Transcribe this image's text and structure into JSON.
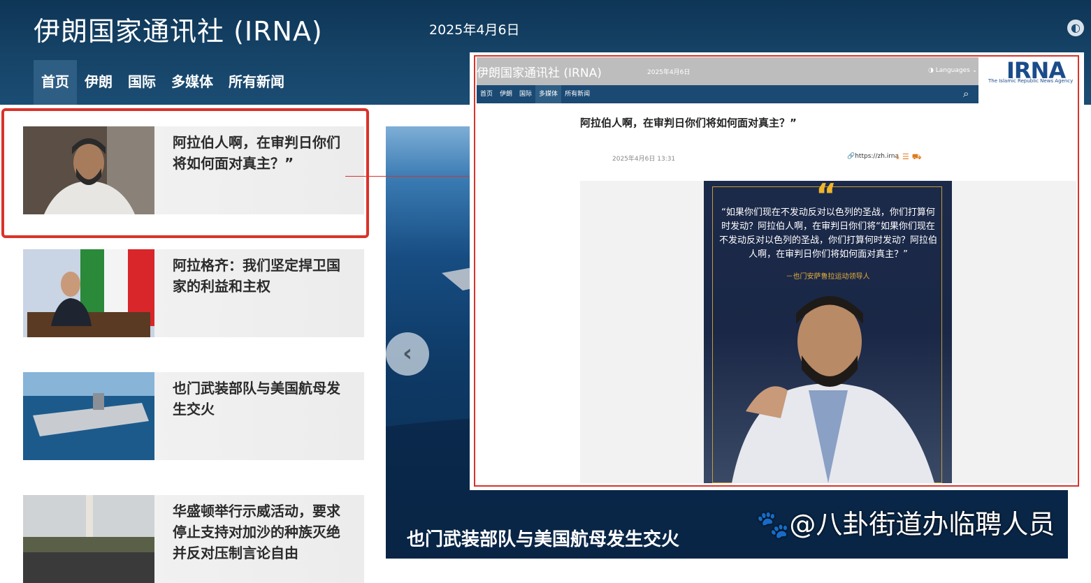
{
  "header": {
    "site_title": "伊朗国家通讯社 (IRNA)",
    "date": "2025年4月6日",
    "nav": [
      "首页",
      "伊朗",
      "国际",
      "多媒体",
      "所有新闻"
    ],
    "active_nav": "首页",
    "globe_icon": "globe-icon"
  },
  "news": [
    {
      "title": "阿拉伯人啊，在审判日你们将如何面对真主？”",
      "thumb": "man-in-white-robe"
    },
    {
      "title": "阿拉格齐：我们坚定捍卫国家的利益和主权",
      "thumb": "speaker-at-podium"
    },
    {
      "title": "也门武装部队与美国航母发生交火",
      "thumb": "aircraft-carrier"
    },
    {
      "title": "华盛顿举行示威活动，要求停止支持对加沙的种族灭绝并反对压制言论自由",
      "thumb": "protest-crowd"
    }
  ],
  "hero": {
    "caption": "也门武装部队与美国航母发生交火",
    "prev_icon": "chevron-left-icon"
  },
  "watermark": "🐾@八卦街道办临聘人员",
  "overlay": {
    "site_title": "伊朗国家通讯社 (IRNA)",
    "date": "2025年4月6日",
    "language": "Languages",
    "logo_text": "IRNA",
    "logo_subtitle": "The Islamic Republic News Agency",
    "nav": [
      "首页",
      "伊朗",
      "国际",
      "多媒体",
      "所有新闻"
    ],
    "active_nav": "多媒体",
    "article_title": "阿拉伯人啊，在审判日你们将如何面对真主？”",
    "article_date": "2025年4月6日 13:31",
    "short_link": "https://zh.irna",
    "poster": {
      "quote_mark": "“",
      "quote": "“如果你们现在不发动反对以色列的圣战，你们打算何时发动？阿拉伯人啊，在审判日你们将“如果你们现在不发动反对以色列的圣战，你们打算何时发动？阿拉伯人啊，在审判日你们将如何面对真主？”",
      "source": "－也门安萨鲁拉运动领导人"
    }
  },
  "colors": {
    "header_bg": "#164468",
    "highlight": "#d9332a",
    "accent_orange": "#e07a18",
    "poster_gold": "#f0b52a"
  }
}
